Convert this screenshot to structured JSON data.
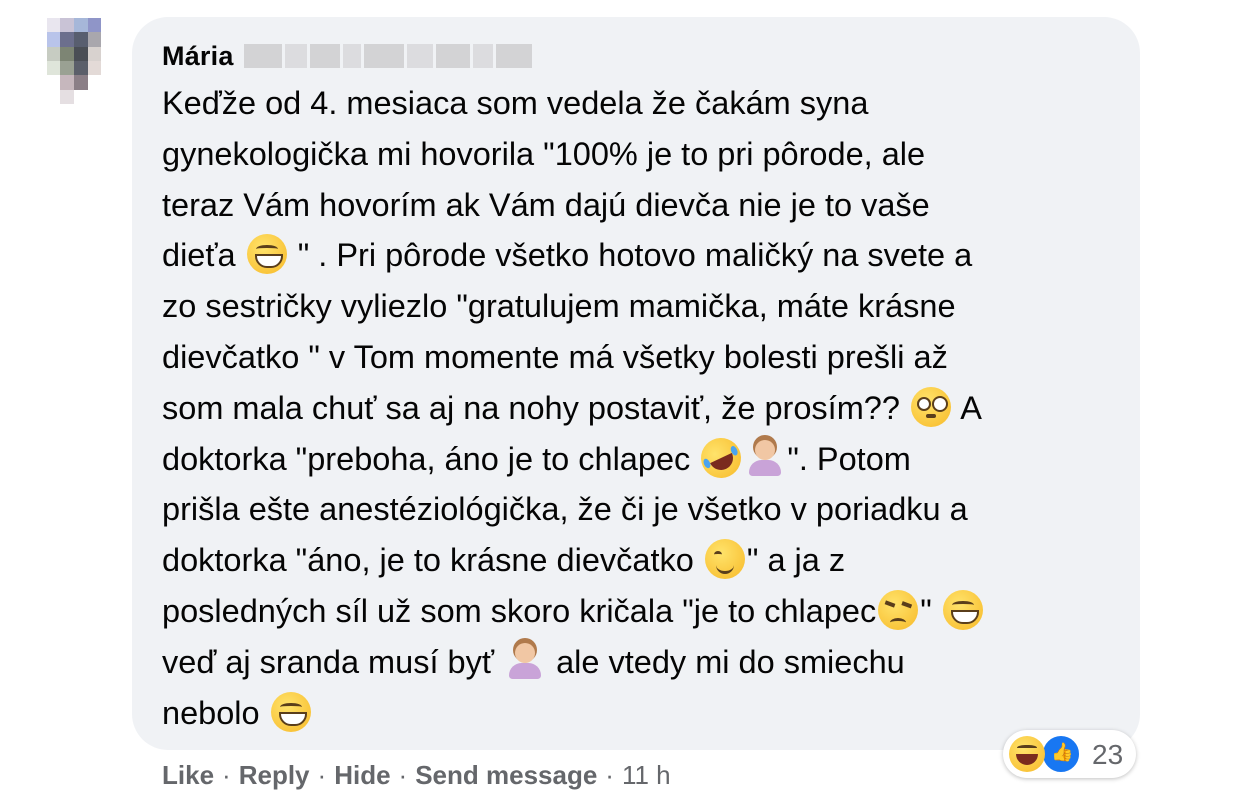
{
  "comment": {
    "author": "Mária",
    "lines": [
      {
        "segments": [
          {
            "t": "Keďže od 4. mesiaca som vedela že čakám syna"
          }
        ]
      },
      {
        "segments": [
          {
            "t": "gynekologička mi hovorila \"100% je to pri pôrode, ale"
          }
        ]
      },
      {
        "segments": [
          {
            "t": "teraz Vám hovorím ak Vám dajú dievča nie je to vaše"
          }
        ]
      },
      {
        "segments": [
          {
            "t": "dieťa "
          },
          {
            "e": "grin"
          },
          {
            "t": " \" . Pri pôrode všetko hotovo maličký na svete a"
          }
        ]
      },
      {
        "segments": [
          {
            "t": "zo sestričky vyliezlo \"gratulujem mamička, máte krásne"
          }
        ]
      },
      {
        "segments": [
          {
            "t": "dievčatko \" v Tom momente má všetky bolesti prešli až"
          }
        ]
      },
      {
        "segments": [
          {
            "t": "som mala chuť sa aj na nohy postaviť, že prosím?? "
          },
          {
            "e": "flushed"
          },
          {
            "t": " A"
          }
        ]
      },
      {
        "segments": [
          {
            "t": "doktorka \"preboha, áno je to chlapec "
          },
          {
            "e": "rofl"
          },
          {
            "e": "person"
          },
          {
            "t": "\". Potom"
          }
        ]
      },
      {
        "segments": [
          {
            "t": "prišla ešte anestéziológička, že či je všetko v poriadku a"
          }
        ]
      },
      {
        "segments": [
          {
            "t": "doktorka \"áno, je to krásne dievčatko "
          },
          {
            "e": "blush"
          },
          {
            "t": "\" a ja z"
          }
        ]
      },
      {
        "segments": [
          {
            "t": "posledných síl už som skoro kričala \"je to chlapec"
          },
          {
            "e": "angry"
          },
          {
            "t": "\" "
          },
          {
            "e": "grin"
          }
        ]
      },
      {
        "segments": [
          {
            "t": "veď aj sranda musí byť "
          },
          {
            "e": "person"
          },
          {
            "t": " ale vtedy mi do smiechu"
          }
        ]
      },
      {
        "segments": [
          {
            "t": "nebolo "
          },
          {
            "e": "grin"
          }
        ]
      }
    ]
  },
  "reactions": {
    "icons": [
      "haha-icon",
      "like-icon"
    ],
    "count": "23"
  },
  "actions": {
    "like": "Like",
    "reply": "Reply",
    "hide": "Hide",
    "send_message": "Send message",
    "separator": "·",
    "time": "11 h"
  },
  "colors": {
    "bubble_bg": "#f0f2f5",
    "meta_text": "#65676b",
    "like_blue": "#1877f2"
  }
}
